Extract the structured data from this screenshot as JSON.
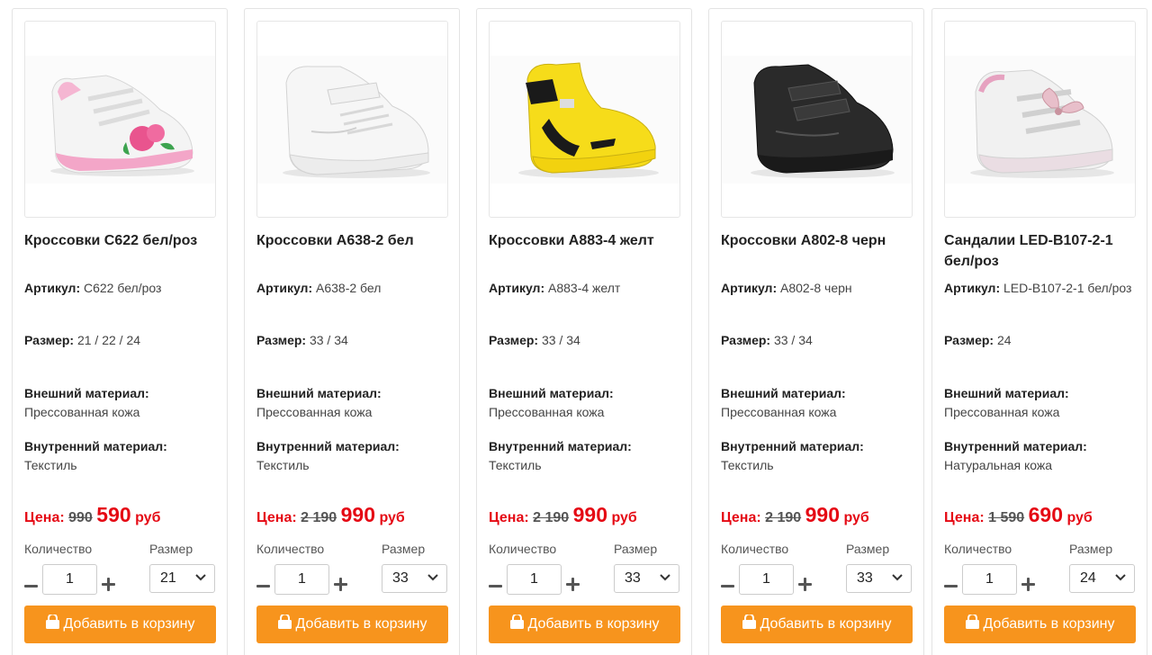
{
  "labels": {
    "article": "Артикул:",
    "size": "Размер:",
    "outer_material": "Внешний материал:",
    "inner_material": "Внутренний материал:",
    "price": "Цена:",
    "currency": "руб",
    "quantity": "Количество",
    "size_select": "Размер",
    "add_to_cart": "Добавить в корзину"
  },
  "colors": {
    "accent": "#f7941d",
    "price": "#e50914"
  },
  "icons": {
    "cart": "shopping-bag-icon",
    "minus": "minus-icon",
    "plus": "plus-icon",
    "dropdown": "chevron-down-icon"
  },
  "products": [
    {
      "title": "Кроссовки C622 бел/роз",
      "article": "C622 бел/роз",
      "sizes": "21 / 22 / 24",
      "outer_material": "Прессованная кожа",
      "inner_material": "Текстиль",
      "old_price": "990",
      "new_price": "590",
      "quantity": "1",
      "selected_size": "21",
      "image": "white-pink-sneaker"
    },
    {
      "title": "Кроссовки A638-2 бел",
      "article": "A638-2 бел",
      "sizes": "33 / 34",
      "outer_material": "Прессованная кожа",
      "inner_material": "Текстиль",
      "old_price": "2 190",
      "new_price": "990",
      "quantity": "1",
      "selected_size": "33",
      "image": "white-sneaker"
    },
    {
      "title": "Кроссовки A883-4 желт",
      "article": "A883-4 желт",
      "sizes": "33 / 34",
      "outer_material": "Прессованная кожа",
      "inner_material": "Текстиль",
      "old_price": "2 190",
      "new_price": "990",
      "quantity": "1",
      "selected_size": "33",
      "image": "yellow-high-sneaker"
    },
    {
      "title": "Кроссовки A802-8 черн",
      "article": "A802-8 черн",
      "sizes": "33 / 34",
      "outer_material": "Прессованная кожа",
      "inner_material": "Текстиль",
      "old_price": "2 190",
      "new_price": "990",
      "quantity": "1",
      "selected_size": "33",
      "image": "black-sneaker"
    },
    {
      "title": "Сандалии LED-B107-2-1 бел/роз",
      "article": "LED-B107-2-1 бел/роз",
      "sizes": "24",
      "outer_material": "Прессованная кожа",
      "inner_material": "Натуральная кожа",
      "old_price": "1 590",
      "new_price": "690",
      "quantity": "1",
      "selected_size": "24",
      "image": "white-pink-sandal"
    }
  ]
}
